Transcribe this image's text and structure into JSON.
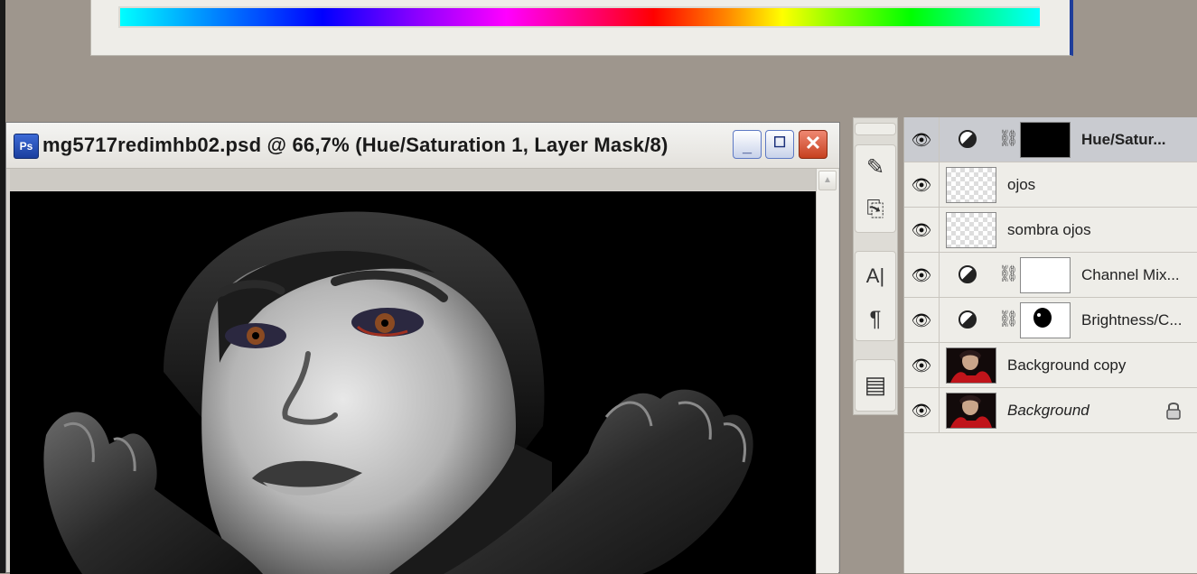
{
  "hue_dialog": {
    "spectrum_colors": [
      "#00ffff",
      "#0000ff",
      "#ff00ff",
      "#ff0000",
      "#ffff00",
      "#00ff00",
      "#00ffff"
    ]
  },
  "document": {
    "icon_label": "Ps",
    "title": "mg5717redimhb02.psd @ 66,7% (Hue/Saturation 1, Layer Mask/8)",
    "buttons": {
      "minimize": "_",
      "maximize": "☐",
      "close": "✕"
    }
  },
  "tools": [
    {
      "name": "brush-tool-icon",
      "glyph": "✎"
    },
    {
      "name": "clone-stamp-icon",
      "glyph": "⎘"
    },
    {
      "name": "type-tool-icon",
      "glyph": "A|"
    },
    {
      "name": "paragraph-icon",
      "glyph": "¶"
    },
    {
      "name": "panel-icon",
      "glyph": "▤"
    }
  ],
  "layers": [
    {
      "name": "Hue/Satur...",
      "kind": "adjustment",
      "mask": "black",
      "selected": true
    },
    {
      "name": "ojos",
      "kind": "pixel",
      "thumb": "checker"
    },
    {
      "name": "sombra ojos",
      "kind": "pixel",
      "thumb": "checker"
    },
    {
      "name": "Channel Mix...",
      "kind": "adjustment",
      "mask": "white"
    },
    {
      "name": "Brightness/C...",
      "kind": "adjustment",
      "mask": "white-dot"
    },
    {
      "name": "Background copy",
      "kind": "pixel",
      "thumb": "photo"
    },
    {
      "name": "Background",
      "kind": "pixel",
      "thumb": "photo",
      "locked": true
    }
  ]
}
